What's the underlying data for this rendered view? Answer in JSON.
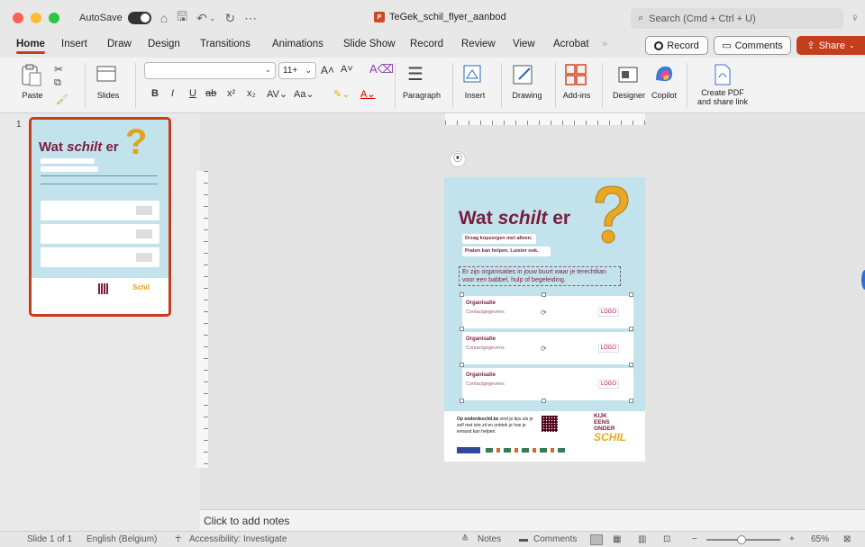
{
  "titlebar": {
    "autosave_label": "AutoSave",
    "doc_title": "TeGek_schil_flyer_aanbod",
    "search_placeholder": "Search (Cmd + Ctrl + U)"
  },
  "tabs": [
    "Home",
    "Insert",
    "Draw",
    "Design",
    "Transitions",
    "Animations",
    "Slide Show",
    "Record",
    "Review",
    "View",
    "Acrobat"
  ],
  "tab_overflow": "»",
  "toolbar_buttons": {
    "record": "Record",
    "comments": "Comments",
    "share": "Share"
  },
  "ribbon": {
    "paste": "Paste",
    "slides": "Slides",
    "font_size": "11+",
    "paragraph": "Paragraph",
    "insert": "Insert",
    "drawing": "Drawing",
    "addins": "Add-ins",
    "designer": "Designer",
    "copilot": "Copilot",
    "create_pdf_line1": "Create PDF",
    "create_pdf_line2": "and share link"
  },
  "thumbnail": {
    "number": "1"
  },
  "slide": {
    "title_plain": "Wat ",
    "title_italic": "schilt",
    "title_end": " er",
    "tag1": "Drzag kopzorgen met alleen.",
    "tag2": "Praten kan helpen. Luister ook.",
    "body": "Er zijn organisaties in jouw buurt waar je terechtkan voor een babbel, hulp of begeleiding.",
    "cards": [
      {
        "org": "Organisatie",
        "contact": "Contactgegevens",
        "logo": "LOGO"
      },
      {
        "org": "Organisatie",
        "contact": "Contactgegevens",
        "logo": "LOGO"
      },
      {
        "org": "Organisatie",
        "contact": "Contactgegevens",
        "logo": "LOGO"
      }
    ],
    "footer_text_bold": "Op enderdeschil.be",
    "footer_text": " vind je tips als je zelf met iets zit en ontdek je hoe je iemand kan helpen.",
    "brand_lines": [
      "KIJK",
      "EENS",
      "ONDER",
      "SCHIL"
    ]
  },
  "notes_placeholder": "Click to add notes",
  "status": {
    "slide_info": "Slide 1 of 1",
    "language": "English (Belgium)",
    "accessibility": "Accessibility: Investigate",
    "notes": "Notes",
    "comments": "Comments",
    "zoom": "65%"
  },
  "colors": {
    "accent": "#c43e1c",
    "slide_bg": "#c3e3ec",
    "title": "#7b1c3e"
  }
}
